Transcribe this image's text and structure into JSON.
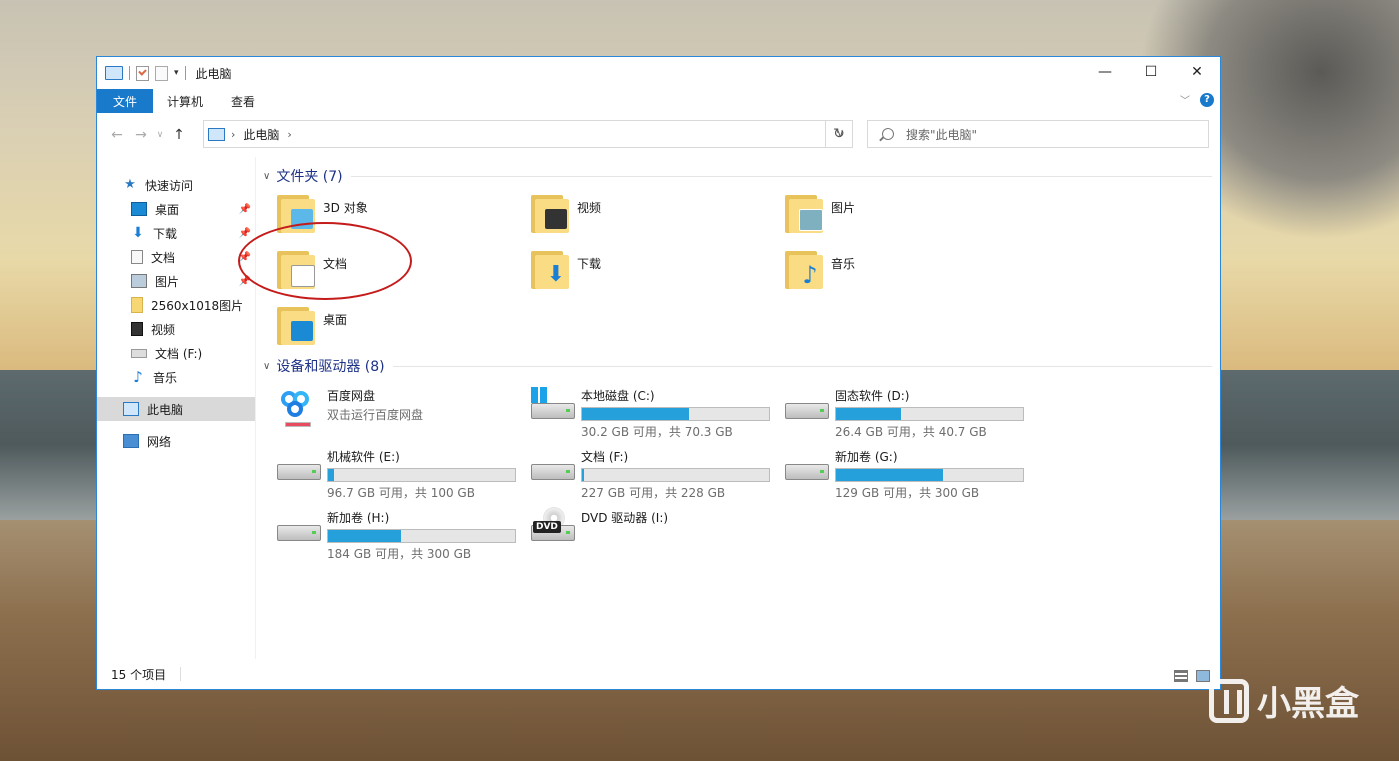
{
  "window": {
    "title": "此电脑",
    "controls": {
      "minimize": "—",
      "maximize": "☐",
      "close": "✕"
    }
  },
  "ribbon": {
    "tabs": [
      "文件",
      "计算机",
      "查看"
    ],
    "help": "?"
  },
  "address": {
    "path": "此电脑",
    "search_placeholder": "搜索\"此电脑\""
  },
  "sidebar": {
    "items": [
      {
        "label": "快速访问",
        "icon": "star-icon"
      },
      {
        "label": "桌面",
        "icon": "desktop-icon",
        "pinned": true
      },
      {
        "label": "下载",
        "icon": "download-icon",
        "pinned": true
      },
      {
        "label": "文档",
        "icon": "documents-icon",
        "pinned": true
      },
      {
        "label": "图片",
        "icon": "pictures-icon",
        "pinned": true
      },
      {
        "label": "2560x1018图片",
        "icon": "folder-icon"
      },
      {
        "label": "视频",
        "icon": "video-icon"
      },
      {
        "label": "文档 (F:)",
        "icon": "drive-icon"
      },
      {
        "label": "音乐",
        "icon": "music-icon"
      },
      {
        "label": "此电脑",
        "icon": "computer-icon",
        "selected": true
      },
      {
        "label": "网络",
        "icon": "network-icon"
      }
    ]
  },
  "folders": {
    "header": "文件夹 (7)",
    "items": [
      {
        "name": "3D 对象",
        "icon": "3d-objects-icon"
      },
      {
        "name": "视频",
        "icon": "videos-folder-icon"
      },
      {
        "name": "图片",
        "icon": "pictures-folder-icon"
      },
      {
        "name": "文档",
        "icon": "documents-folder-icon"
      },
      {
        "name": "下载",
        "icon": "downloads-folder-icon"
      },
      {
        "name": "音乐",
        "icon": "music-folder-icon"
      },
      {
        "name": "桌面",
        "icon": "desktop-folder-icon"
      }
    ]
  },
  "drives": {
    "header": "设备和驱动器 (8)",
    "items": [
      {
        "name": "百度网盘",
        "sub": "双击运行百度网盘",
        "icon": "baidu-netdisk-icon"
      },
      {
        "name": "本地磁盘 (C:)",
        "sub": "30.2 GB 可用，共 70.3 GB",
        "used_fraction": 0.57,
        "icon": "system-drive-icon"
      },
      {
        "name": "固态软件 (D:)",
        "sub": "26.4 GB 可用，共 40.7 GB",
        "used_fraction": 0.35,
        "icon": "hard-drive-icon"
      },
      {
        "name": "机械软件 (E:)",
        "sub": "96.7 GB 可用，共 100 GB",
        "used_fraction": 0.03,
        "icon": "hard-drive-icon"
      },
      {
        "name": "文档 (F:)",
        "sub": "227 GB 可用，共 228 GB",
        "used_fraction": 0.005,
        "icon": "hard-drive-icon"
      },
      {
        "name": "新加卷 (G:)",
        "sub": "129 GB 可用，共 300 GB",
        "used_fraction": 0.57,
        "icon": "hard-drive-icon"
      },
      {
        "name": "新加卷 (H:)",
        "sub": "184 GB 可用，共 300 GB",
        "used_fraction": 0.39,
        "icon": "hard-drive-icon"
      },
      {
        "name": "DVD 驱动器 (I:)",
        "icon": "dvd-drive-icon"
      }
    ]
  },
  "status": {
    "count": "15 个项目"
  },
  "watermark": {
    "text": "小黑盒"
  },
  "colors": {
    "accent": "#1979ca",
    "bar_fill": "#26a0da",
    "annotation": "#c41b1b"
  }
}
